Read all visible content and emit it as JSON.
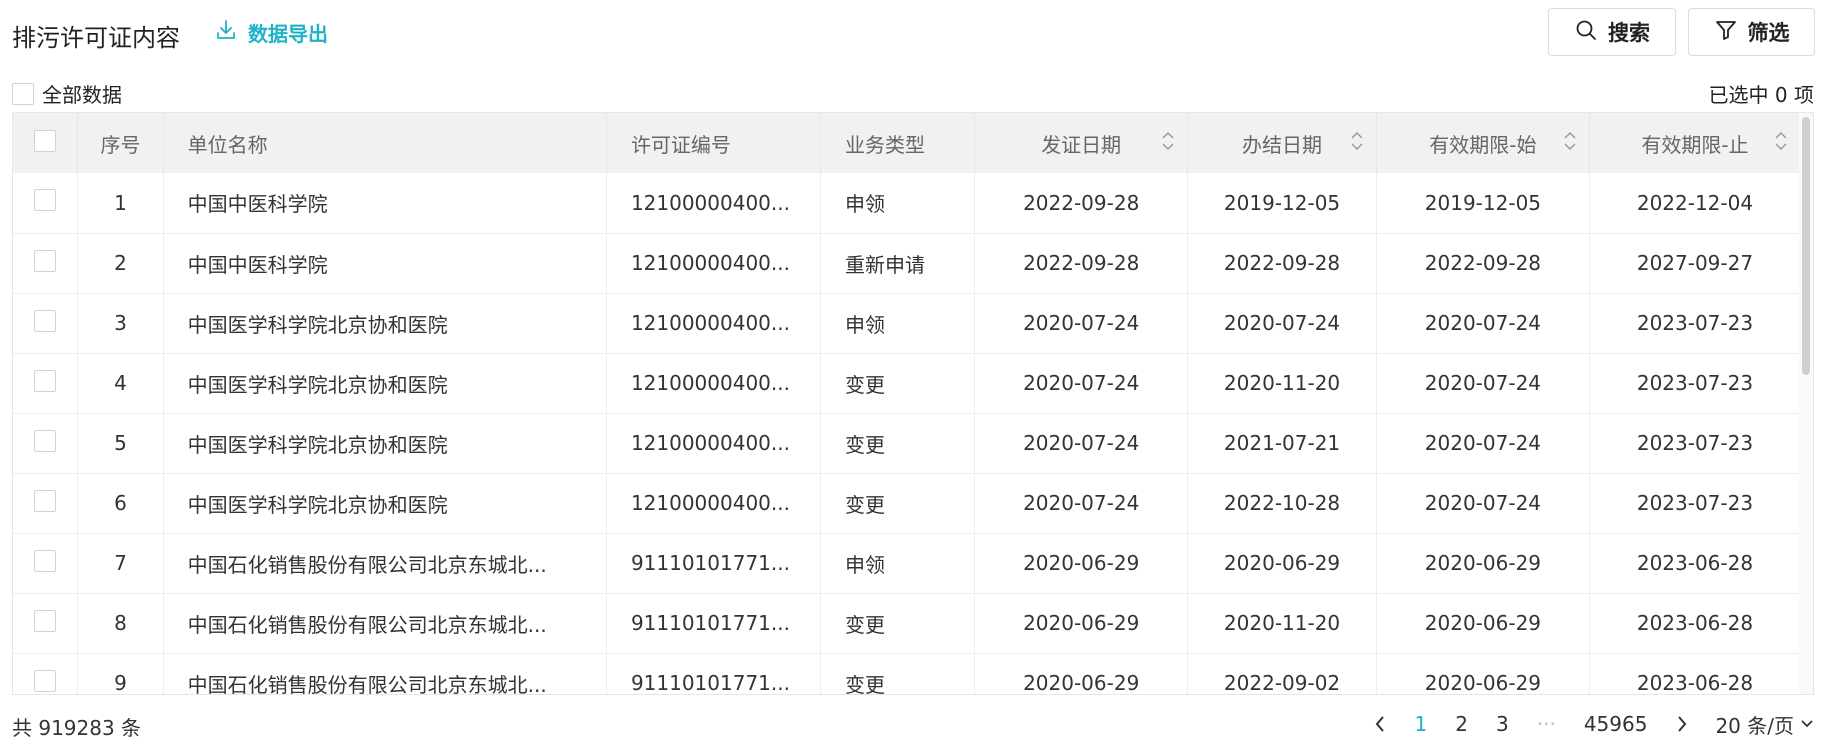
{
  "header": {
    "title": "排污许可证内容",
    "export_label": "数据导出",
    "search_label": "搜索",
    "filter_label": "筛选"
  },
  "toolbar": {
    "all_data_label": "全部数据",
    "selected_text": "已选中 0 项"
  },
  "table": {
    "columns": [
      "序号",
      "单位名称",
      "许可证编号",
      "业务类型",
      "发证日期",
      "办结日期",
      "有效期限-始",
      "有效期限-止"
    ],
    "rows": [
      [
        "1",
        "中国中医科学院",
        "12100000400...",
        "申领",
        "2022-09-28",
        "2019-12-05",
        "2019-12-05",
        "2022-12-04"
      ],
      [
        "2",
        "中国中医科学院",
        "12100000400...",
        "重新申请",
        "2022-09-28",
        "2022-09-28",
        "2022-09-28",
        "2027-09-27"
      ],
      [
        "3",
        "中国医学科学院北京协和医院",
        "12100000400...",
        "申领",
        "2020-07-24",
        "2020-07-24",
        "2020-07-24",
        "2023-07-23"
      ],
      [
        "4",
        "中国医学科学院北京协和医院",
        "12100000400...",
        "变更",
        "2020-07-24",
        "2020-11-20",
        "2020-07-24",
        "2023-07-23"
      ],
      [
        "5",
        "中国医学科学院北京协和医院",
        "12100000400...",
        "变更",
        "2020-07-24",
        "2021-07-21",
        "2020-07-24",
        "2023-07-23"
      ],
      [
        "6",
        "中国医学科学院北京协和医院",
        "12100000400...",
        "变更",
        "2020-07-24",
        "2022-10-28",
        "2020-07-24",
        "2023-07-23"
      ],
      [
        "7",
        "中国石化销售股份有限公司北京东城北...",
        "91110101771...",
        "申领",
        "2020-06-29",
        "2020-06-29",
        "2020-06-29",
        "2023-06-28"
      ],
      [
        "8",
        "中国石化销售股份有限公司北京东城北...",
        "91110101771...",
        "变更",
        "2020-06-29",
        "2020-11-20",
        "2020-06-29",
        "2023-06-28"
      ],
      [
        "9",
        "中国石化销售股份有限公司北京东城北...",
        "91110101771...",
        "变更",
        "2020-06-29",
        "2022-09-02",
        "2020-06-29",
        "2023-06-28"
      ]
    ]
  },
  "footer": {
    "total_text": "共 919283 条",
    "pages": [
      "1",
      "2",
      "3"
    ],
    "ellipsis": "···",
    "last_page": "45965",
    "page_size": "20 条/页"
  },
  "colors": {
    "accent": "#1fb3c8",
    "header_bg": "#f1f1f1",
    "border": "#e6e6e6"
  },
  "icons": {
    "export": "download-icon",
    "search": "search-icon",
    "filter": "filter-icon",
    "sort": "sort-icon",
    "prev": "chevron-left-icon",
    "next": "chevron-right-icon",
    "dropdown": "chevron-down-icon"
  }
}
